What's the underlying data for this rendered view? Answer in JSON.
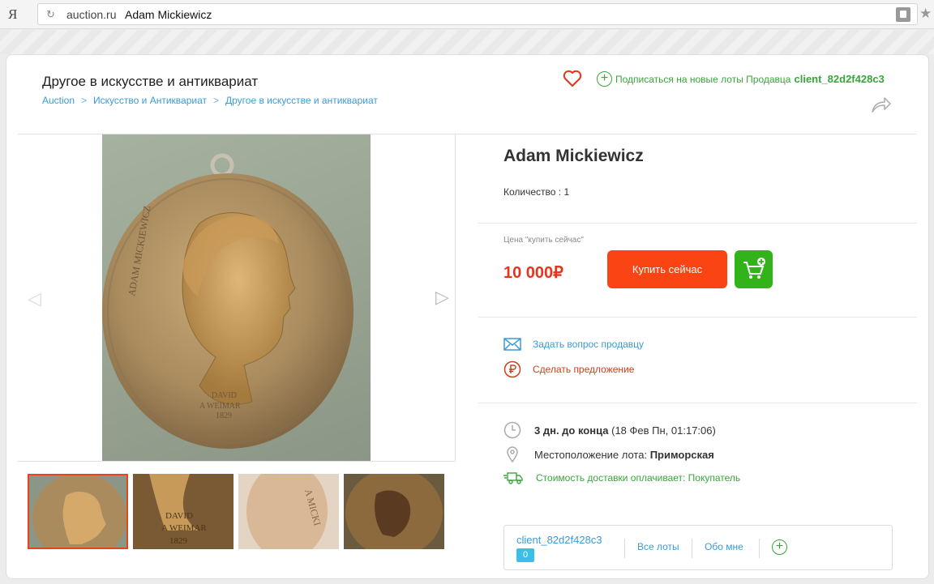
{
  "browser": {
    "logo": "Я",
    "domain": "auction.ru",
    "page_title": "Adam Mickiewicz"
  },
  "header": {
    "category_title": "Другое в искусстве и антиквариат",
    "breadcrumb": [
      "Auction",
      "Искусство и Антиквариат",
      "Другое в искусстве и антиквариат"
    ],
    "breadcrumb_sep": ">",
    "subscribe_text": "Подписаться на новые лоты Продавца",
    "seller_id": "client_82d2f428c3"
  },
  "product": {
    "title": "Adam Mickiewicz",
    "quantity": "Количество : 1",
    "price_label": "Цена \"купить сейчас\"",
    "price": "10 000₽",
    "buy_label": "Купить сейчас",
    "ask_seller": "Задать вопрос продавцу",
    "make_offer": "Сделать предложение",
    "time_left_bold": "3 дн. до конца",
    "time_left_detail": "(18 Фев Пн, 01:17:06)",
    "location_label": "Местоположение лота:",
    "location_value": "Приморская",
    "shipping": "Стоимость доставки оплачивает: Покупатель"
  },
  "seller_box": {
    "name": "client_82d2f428c3",
    "badge": "0",
    "all_lots": "Все лоты",
    "about": "Обо мне"
  },
  "thumbnails": [
    "medal-front",
    "medal-detail-signature",
    "medal-edge",
    "medal-reverse"
  ],
  "colors": {
    "accent_red": "#fa4414",
    "price_red": "#e4351d",
    "green": "#32b319",
    "link_blue": "#3a9bd8"
  }
}
